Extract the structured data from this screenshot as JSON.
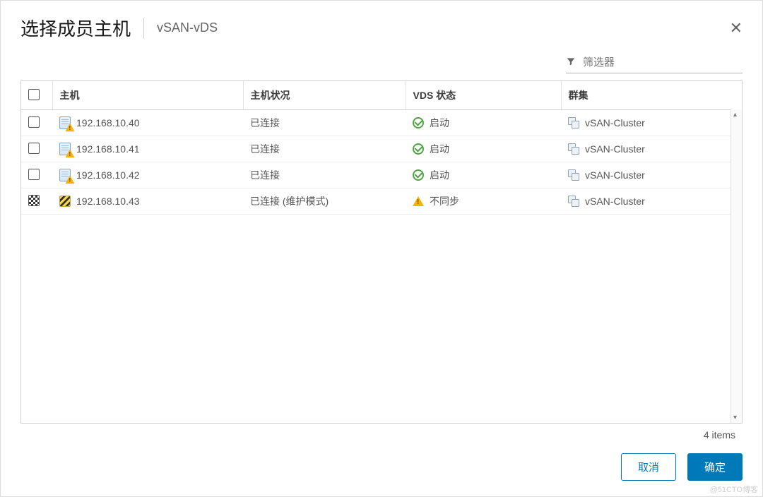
{
  "modal": {
    "title": "选择成员主机",
    "subtitle": "vSAN-vDS"
  },
  "filter": {
    "placeholder": "筛选器"
  },
  "columns": {
    "host": "主机",
    "host_status": "主机状况",
    "vds_status": "VDS 状态",
    "cluster": "群集"
  },
  "rows": [
    {
      "checked": false,
      "host_icon": "host-warning",
      "host": "192.168.10.40",
      "status": "已连接",
      "vds_icon": "ok",
      "vds": "启动",
      "cluster": "vSAN-Cluster"
    },
    {
      "checked": false,
      "host_icon": "host-warning",
      "host": "192.168.10.41",
      "status": "已连接",
      "vds_icon": "ok",
      "vds": "启动",
      "cluster": "vSAN-Cluster"
    },
    {
      "checked": false,
      "host_icon": "host-warning",
      "host": "192.168.10.42",
      "status": "已连接",
      "vds_icon": "ok",
      "vds": "启动",
      "cluster": "vSAN-Cluster"
    },
    {
      "checked": true,
      "host_icon": "host-maintenance",
      "host": "192.168.10.43",
      "status": "已连接 (维护模式)",
      "vds_icon": "warn",
      "vds": "不同步",
      "cluster": "vSAN-Cluster"
    }
  ],
  "footer": {
    "count_text": "4 items"
  },
  "buttons": {
    "cancel": "取消",
    "ok": "确定"
  },
  "watermark": "@51CTO博客"
}
